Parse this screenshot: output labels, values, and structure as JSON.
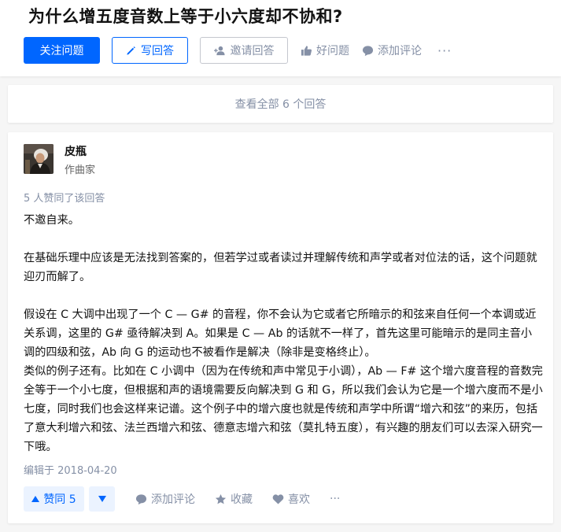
{
  "question": {
    "title": "为什么增五度音数上等于小六度却不协和?",
    "actions": {
      "follow": "关注问题",
      "write": "写回答",
      "invite": "邀请回答",
      "good": "好问题",
      "comment": "添加评论",
      "more": "···"
    }
  },
  "view_all": "查看全部 6 个回答",
  "answer": {
    "author": {
      "name": "皮瓶",
      "bio": "作曲家"
    },
    "votes_text": "5 人赞同了该回答",
    "paragraphs": [
      "不邀自来。",
      "在基础乐理中应该是无法找到答案的，但若学过或者读过并理解传统和声学或者对位法的话，这个问题就迎刃而解了。",
      "假设在 C 大调中出现了一个 C — G# 的音程，你不会认为它或者它所暗示的和弦来自任何一个本调或近关系调，这里的 G# 亟待解决到 A。如果是 C — Ab 的话就不一样了，首先这里可能暗示的是同主音小调的四级和弦，Ab 向 G 的运动也不被看作是解决（除非是变格终止）。",
      "类似的例子还有。比如在 C 小调中（因为在传统和声中常见于小调），Ab — F# 这个增六度音程的音数完全等于一个小七度，但根据和声的语境需要反向解决到 G 和 G，所以我们会认为它是一个增六度而不是小七度，同时我们也会这样来记谱。这个例子中的增六度也就是传统和声学中所谓“增六和弦”的来历，包括了意大利增六和弦、法兰西增六和弦、德意志增六和弦（莫扎特五度），有兴趣的朋友们可以去深入研究一下哦。"
    ],
    "edit_time": "编辑于 2018-04-20",
    "actions": {
      "upvote": "赞同 5",
      "comment": "添加评论",
      "collect": "收藏",
      "like": "喜欢",
      "more": "···"
    }
  },
  "colors": {
    "brand": "#0066ff",
    "muted": "#8590a6"
  }
}
